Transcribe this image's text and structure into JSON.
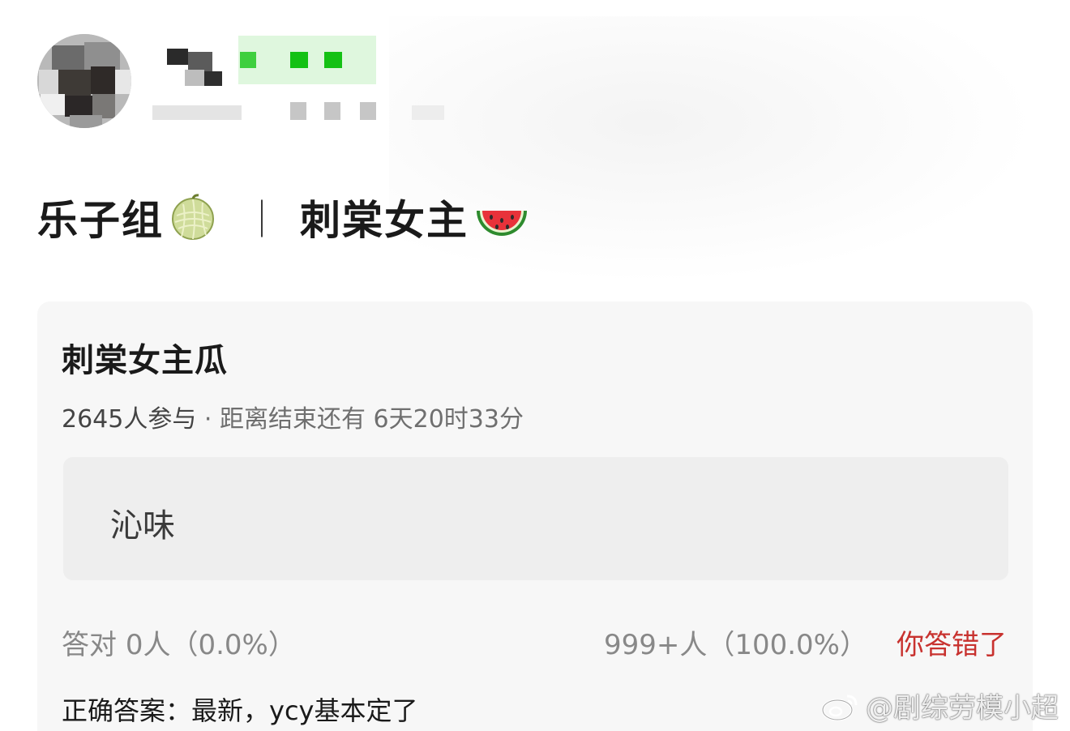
{
  "post": {
    "title_part1": "乐子组",
    "title_separator": "｜",
    "title_part2": "刺棠女主",
    "icons": [
      "melon-icon",
      "watermelon-icon"
    ]
  },
  "quiz": {
    "title": "刺棠女主瓜",
    "participants": "2645人参与",
    "dot": "·",
    "countdown_label": "距离结束还有",
    "countdown_value": "6天20时33分",
    "option_text": "沁味",
    "correct_label": "答对",
    "correct_value": "0人（0.0%）",
    "wrong_value": "999+人（100.0%）",
    "wrong_status": "你答错了",
    "answer_text": "正确答案：最新，ycy基本定了"
  },
  "watermark": {
    "text": "@剧综劳模小超",
    "icon": "weibo-logo-icon"
  },
  "colors": {
    "wrong_red": "#c8322f",
    "card_bg": "#f7f7f7",
    "option_bg": "#eeeeee",
    "green_mosaic": "#22c322"
  }
}
